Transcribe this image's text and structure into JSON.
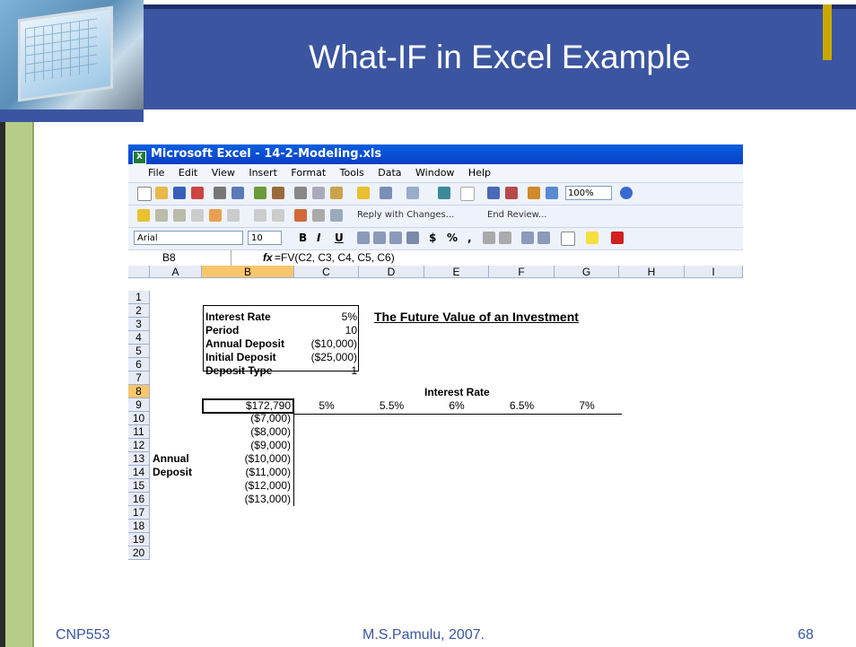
{
  "slide": {
    "title": "What-IF in Excel Example",
    "footer_left": "CNP553",
    "footer_center": "M.S.Pamulu, 2007.",
    "footer_right": "68"
  },
  "colors": {
    "title_band": "#3b55a0",
    "accent_gold": "#c8a800",
    "left_green": "#b8cc8a",
    "footer_text": "#3b55a0"
  },
  "excel": {
    "window_title": "Microsoft Excel - 14-2-Modeling.xls",
    "menu": [
      "File",
      "Edit",
      "View",
      "Insert",
      "Format",
      "Tools",
      "Data",
      "Window",
      "Help"
    ],
    "zoom": "100%",
    "reply_with_changes": "Reply with Changes...",
    "end_review": "End Review...",
    "font_name": "Arial",
    "font_size": "10",
    "format_buttons": [
      "B",
      "I",
      "U",
      "$",
      "%",
      ","
    ],
    "name_box": "B8",
    "fx": "fx",
    "formula": "=FV(C2, C3, C4, C5, C6)",
    "columns": [
      "A",
      "B",
      "C",
      "D",
      "E",
      "F",
      "G",
      "H",
      "I"
    ],
    "rows": [
      "1",
      "2",
      "3",
      "4",
      "5",
      "6",
      "7",
      "8",
      "9",
      "10",
      "11",
      "12",
      "13",
      "14",
      "15",
      "16",
      "17",
      "18",
      "19",
      "20"
    ],
    "params": [
      {
        "label": "Interest Rate",
        "value": "5%"
      },
      {
        "label": "Period",
        "value": "10"
      },
      {
        "label": "Annual Deposit",
        "value": "($10,000)"
      },
      {
        "label": "Initial Deposit",
        "value": "($25,000)"
      },
      {
        "label": "Deposit Type",
        "value": "1"
      }
    ],
    "heading": "The Future Value of an Investment",
    "interest_rate_label": "Interest Rate",
    "fv_result": "$172,790",
    "rates": [
      "5%",
      "5.5%",
      "6%",
      "6.5%",
      "7%"
    ],
    "deposit_label_1": "Annual",
    "deposit_label_2": "Deposit",
    "deposits": [
      "($7,000)",
      "($8,000)",
      "($9,000)",
      "($10,000)",
      "($11,000)",
      "($12,000)",
      "($13,000)"
    ]
  }
}
